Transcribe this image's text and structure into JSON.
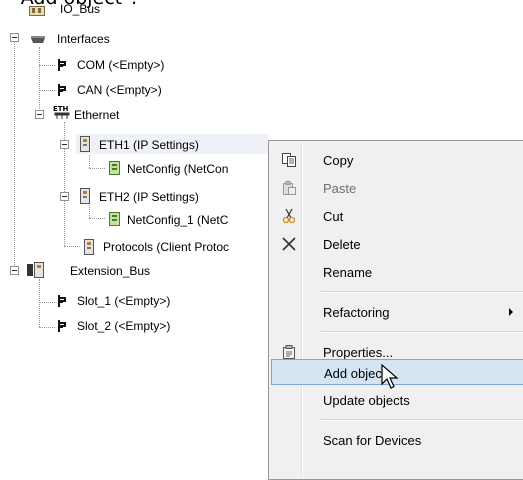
{
  "caption": "\"Add object\":",
  "tree": {
    "io_bus": "IO_Bus",
    "interfaces": "Interfaces",
    "com": "COM (<Empty>)",
    "can": "CAN (<Empty>)",
    "ethernet": "Ethernet",
    "eth1": "ETH1 (IP Settings)",
    "netconfig": "NetConfig (NetCon",
    "eth2": "ETH2 (IP Settings)",
    "netconfig1": "NetConfig_1 (NetC",
    "protocols": "Protocols (Client Protoc",
    "extension_bus": "Extension_Bus",
    "slot1": "Slot_1 (<Empty>)",
    "slot2": "Slot_2 (<Empty>)"
  },
  "menu": {
    "copy": "Copy",
    "paste": "Paste",
    "cut": "Cut",
    "delete": "Delete",
    "rename": "Rename",
    "refactoring": "Refactoring",
    "properties": "Properties...",
    "add_object": "Add object",
    "update_objects": "Update objects",
    "scan": "Scan for Devices"
  },
  "colors": {
    "highlight": "#d5e4f2",
    "highlight_border": "#7aa7d8",
    "menu_bg": "#f0f0f0"
  }
}
